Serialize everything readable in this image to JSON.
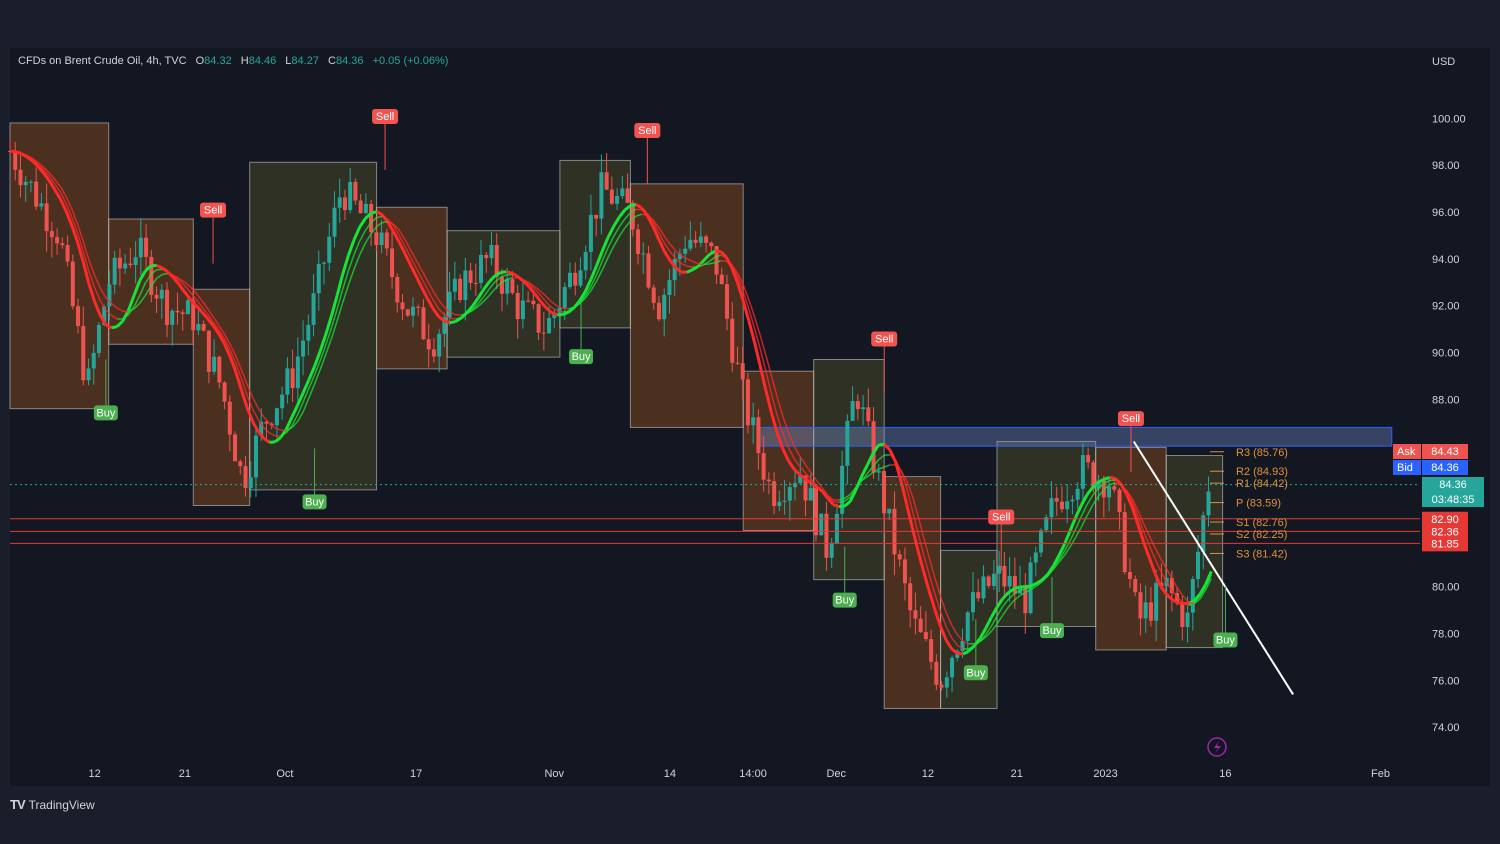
{
  "header": {
    "symbol": "CFDs on Brent Crude Oil, 4h, TVC",
    "open_label": "O",
    "open": "84.32",
    "high_label": "H",
    "high": "84.46",
    "low_label": "L",
    "low": "84.27",
    "close_label": "C",
    "close": "84.36",
    "change": "+0.05 (+0.06%)"
  },
  "currency": "USD",
  "brand": {
    "logo": "TV",
    "name": "TradingView"
  },
  "colors": {
    "background": "#1a1e2b",
    "bull": "#26a69a",
    "bear": "#ef5350",
    "sell_label": "#f05350",
    "buy_label": "#4caf50",
    "ribbon_red": "#ff2a2a",
    "ribbon_green": "#18e33a",
    "pivot": "#e0913a",
    "support_line": "#e53935",
    "zone": "#2962ff",
    "trendline": "#ffffff",
    "bid": "#2962ff",
    "current": "#26a69a"
  },
  "chart_data": {
    "type": "candlestick",
    "ylim": [
      72.6,
      103.0
    ],
    "y_ticks": [
      100,
      98,
      96,
      94,
      92,
      90,
      88,
      80,
      78,
      76,
      74
    ],
    "y_tick_labels": [
      "100.00",
      "98.00",
      "96.00",
      "94.00",
      "92.00",
      "90.00",
      "88.00",
      "80.00",
      "78.00",
      "76.00",
      "74.00"
    ],
    "x_ticks": [
      {
        "label": "12",
        "pos": 0.06
      },
      {
        "label": "21",
        "pos": 0.124
      },
      {
        "label": "Oct",
        "pos": 0.195
      },
      {
        "label": "17",
        "pos": 0.288
      },
      {
        "label": "Nov",
        "pos": 0.386
      },
      {
        "label": "14",
        "pos": 0.468
      },
      {
        "label": "14:00",
        "pos": 0.527
      },
      {
        "label": "Dec",
        "pos": 0.586
      },
      {
        "label": "12",
        "pos": 0.651
      },
      {
        "label": "21",
        "pos": 0.714
      },
      {
        "label": "2023",
        "pos": 0.777
      },
      {
        "label": "16",
        "pos": 0.862
      },
      {
        "label": "Feb",
        "pos": 0.972
      }
    ],
    "price_path": [
      [
        0,
        98.6
      ],
      [
        0.02,
        96.5
      ],
      [
        0.035,
        95.0
      ],
      [
        0.055,
        88.5
      ],
      [
        0.07,
        93.0
      ],
      [
        0.09,
        94.5
      ],
      [
        0.11,
        92.0
      ],
      [
        0.13,
        91.5
      ],
      [
        0.15,
        88.5
      ],
      [
        0.165,
        84.5
      ],
      [
        0.18,
        87.0
      ],
      [
        0.2,
        89.0
      ],
      [
        0.215,
        92.0
      ],
      [
        0.235,
        97.0
      ],
      [
        0.26,
        95.0
      ],
      [
        0.28,
        92.0
      ],
      [
        0.3,
        90.5
      ],
      [
        0.32,
        93.0
      ],
      [
        0.34,
        94.0
      ],
      [
        0.36,
        92.0
      ],
      [
        0.38,
        91.0
      ],
      [
        0.4,
        93.5
      ],
      [
        0.42,
        97.0
      ],
      [
        0.44,
        96.0
      ],
      [
        0.46,
        92.0
      ],
      [
        0.48,
        95.0
      ],
      [
        0.5,
        94.0
      ],
      [
        0.52,
        88.0
      ],
      [
        0.54,
        84.0
      ],
      [
        0.56,
        85.0
      ],
      [
        0.58,
        81.5
      ],
      [
        0.6,
        88.5
      ],
      [
        0.62,
        83.5
      ],
      [
        0.64,
        78.5
      ],
      [
        0.66,
        76.0
      ],
      [
        0.68,
        79.0
      ],
      [
        0.7,
        80.5
      ],
      [
        0.72,
        79.5
      ],
      [
        0.74,
        83.5
      ],
      [
        0.76,
        85.0
      ],
      [
        0.78,
        84.5
      ],
      [
        0.8,
        78.5
      ],
      [
        0.82,
        80.0
      ],
      [
        0.835,
        78.5
      ],
      [
        0.85,
        84.4
      ]
    ],
    "signals": [
      {
        "type": "sell",
        "label": "Sell",
        "x": 0.144,
        "price": 95.5
      },
      {
        "type": "sell",
        "label": "Sell",
        "x": 0.266,
        "price": 99.5
      },
      {
        "type": "sell",
        "label": "Sell",
        "x": 0.452,
        "price": 98.9
      },
      {
        "type": "sell",
        "label": "Sell",
        "x": 0.62,
        "price": 90.0
      },
      {
        "type": "sell",
        "label": "Sell",
        "x": 0.703,
        "price": 82.4
      },
      {
        "type": "sell",
        "label": "Sell",
        "x": 0.795,
        "price": 86.6
      },
      {
        "type": "buy",
        "label": "Buy",
        "x": 0.068,
        "price": 88.0
      },
      {
        "type": "buy",
        "label": "Buy",
        "x": 0.216,
        "price": 84.2
      },
      {
        "type": "buy",
        "label": "Buy",
        "x": 0.405,
        "price": 90.4
      },
      {
        "type": "buy",
        "label": "Buy",
        "x": 0.592,
        "price": 80.0
      },
      {
        "type": "buy",
        "label": "Buy",
        "x": 0.685,
        "price": 76.9
      },
      {
        "type": "buy",
        "label": "Buy",
        "x": 0.739,
        "price": 78.7
      },
      {
        "type": "buy",
        "label": "Buy",
        "x": 0.862,
        "price": 78.3
      }
    ],
    "pivots": [
      {
        "label": "R3 (85.76)",
        "value": 85.76
      },
      {
        "label": "R2 (84.93)",
        "value": 84.93
      },
      {
        "label": "R1 (84.42)",
        "value": 84.42
      },
      {
        "label": "P (83.59)",
        "value": 83.59
      },
      {
        "label": "S1 (82.76)",
        "value": 82.76
      },
      {
        "label": "S2 (82.25)",
        "value": 82.25
      },
      {
        "label": "S3 (81.42)",
        "value": 81.42
      }
    ],
    "support_lines": [
      82.9,
      82.36,
      81.85
    ],
    "resistance_zone": {
      "from": 86.0,
      "to": 86.8,
      "x_start": 0.53,
      "x_end": 0.98
    },
    "trendline": {
      "from": [
        0.797,
        86.2
      ],
      "to": [
        0.91,
        75.4
      ]
    },
    "price_badges": {
      "ask_label": "Ask",
      "ask": "84.43",
      "bid_label": "Bid",
      "bid": "84.36",
      "last": "84.36",
      "countdown": "03:48:35",
      "levels": [
        "82.90",
        "82.36",
        "81.85"
      ]
    }
  }
}
